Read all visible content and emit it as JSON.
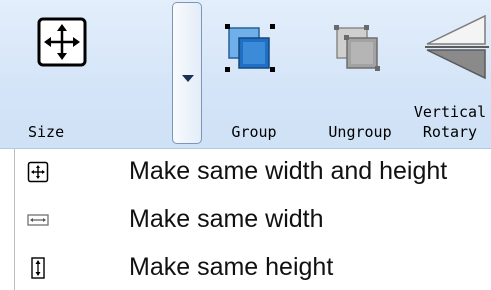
{
  "ribbon": {
    "buttons": [
      {
        "id": "size",
        "label": "Size",
        "icon": "move-arrows-icon"
      },
      {
        "id": "group",
        "label": "Group",
        "icon": "group-icon"
      },
      {
        "id": "ungroup",
        "label": "Ungroup",
        "icon": "ungroup-icon"
      },
      {
        "id": "vertical-rotary",
        "label": "Vertical\nRotary",
        "icon": "vertical-rotary-icon"
      }
    ],
    "size_dropdown_icon": "dropdown-arrow-icon"
  },
  "size_menu": {
    "items": [
      {
        "label": "Make same width and height",
        "icon": "same-size-icon"
      },
      {
        "label": "Make same width",
        "icon": "same-width-icon"
      },
      {
        "label": "Make same height",
        "icon": "same-height-icon"
      }
    ]
  },
  "colors": {
    "ribbon_bg": "#d5e5f8",
    "icon_blue": "#1f6fc5",
    "icon_gray": "#8f8f8f"
  }
}
